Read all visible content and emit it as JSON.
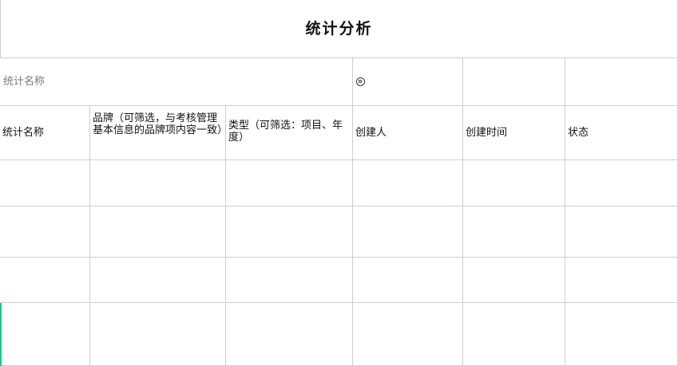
{
  "title": "统计分析",
  "search": {
    "label": "统计名称",
    "radio_icon": "radio-icon"
  },
  "columns": [
    "统计名称",
    "品牌（可筛选，与考核管理基本信息的品牌项内容一致）",
    "类型（可筛选：项目、年度）",
    "创建人",
    "创建时间",
    "状态"
  ],
  "rows": [
    [
      "",
      "",
      "",
      "",
      "",
      ""
    ],
    [
      "",
      "",
      "",
      "",
      "",
      ""
    ],
    [
      "",
      "",
      "",
      "",
      "",
      ""
    ],
    [
      "",
      "",
      "",
      "",
      "",
      ""
    ]
  ],
  "colors": {
    "grid": "#c9cfd8",
    "accent": "#1cc98a"
  }
}
